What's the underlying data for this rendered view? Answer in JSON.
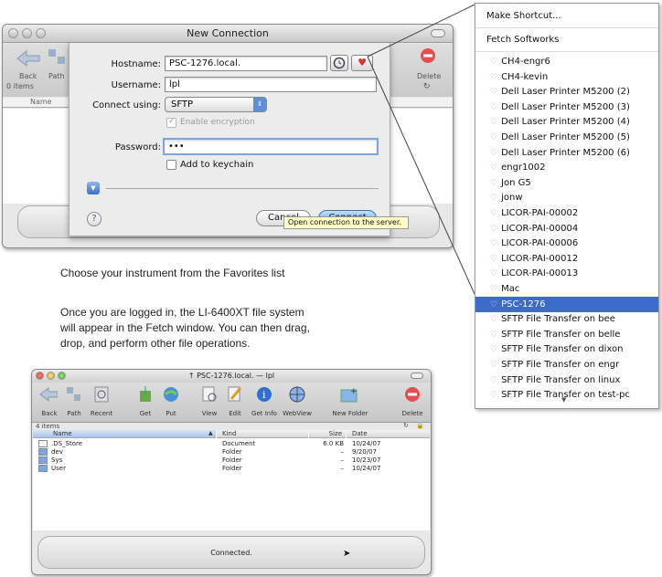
{
  "top_window": {
    "title": "New Connection",
    "toolbar": {
      "back": "Back",
      "path": "Path",
      "delete": "Delete"
    },
    "items_count": "0 items",
    "column_name": "Name",
    "form": {
      "hostname_label": "Hostname:",
      "hostname_value": "PSC-1276.local.",
      "username_label": "Username:",
      "username_value": "lpl",
      "connect_using_label": "Connect using:",
      "connect_using_value": "SFTP",
      "encryption_label": "Enable encryption",
      "password_label": "Password:",
      "password_value": "•••",
      "keychain_label": "Add to keychain",
      "cancel": "Cancel",
      "connect": "Connect",
      "help": "?",
      "tooltip": "Open connection to the server."
    }
  },
  "favorites_menu": {
    "make_shortcut": "Make Shortcut...",
    "fetch_softworks": "Fetch Softworks",
    "items": [
      "CH4-engr6",
      "CH4-kevin",
      "Dell Laser Printer M5200 (2)",
      "Dell Laser Printer M5200 (3)",
      "Dell Laser Printer M5200 (4)",
      "Dell Laser Printer M5200 (5)",
      "Dell Laser Printer M5200 (6)",
      "engr1002",
      "Jon G5",
      "jonw",
      "LICOR-PAI-00002",
      "LICOR-PAI-00004",
      "LICOR-PAI-00006",
      "LICOR-PAI-00012",
      "LICOR-PAI-00013",
      "Mac",
      "PSC-1276",
      "SFTP File Transfer on bee",
      "SFTP File Transfer on belle",
      "SFTP File Transfer on dixon",
      "SFTP File Transfer on engr",
      "SFTP File Transfer on linux",
      "SFTP File Transfer on test-pc"
    ],
    "selected": "PSC-1276"
  },
  "text": {
    "p1": "Choose your instrument from the Favorites list",
    "p2a": "Once you are logged in, the LI-6400XT file system",
    "p2b": "will appear in the Fetch window.  You can then drag,",
    "p2c": "drop, and perform other file operations."
  },
  "bottom_window": {
    "title": "PSC-1276.local. — lpl",
    "toolbar": [
      "Back",
      "Path",
      "Recent",
      "Get",
      "Put",
      "View",
      "Edit",
      "Get Info",
      "WebView",
      "New Folder",
      "Delete"
    ],
    "items_count": "4 items",
    "columns": {
      "name": "Name",
      "kind": "Kind",
      "size": "Size",
      "date": "Date"
    },
    "rows": [
      {
        "name": ".DS_Store",
        "kind": "Document",
        "size": "6.0 KB",
        "date": "10/24/07"
      },
      {
        "name": "dev",
        "kind": "Folder",
        "size": "–",
        "date": "9/20/07"
      },
      {
        "name": "Sys",
        "kind": "Folder",
        "size": "–",
        "date": "10/23/07"
      },
      {
        "name": "User",
        "kind": "Folder",
        "size": "–",
        "date": "10/24/07"
      }
    ],
    "status": "Connected."
  }
}
